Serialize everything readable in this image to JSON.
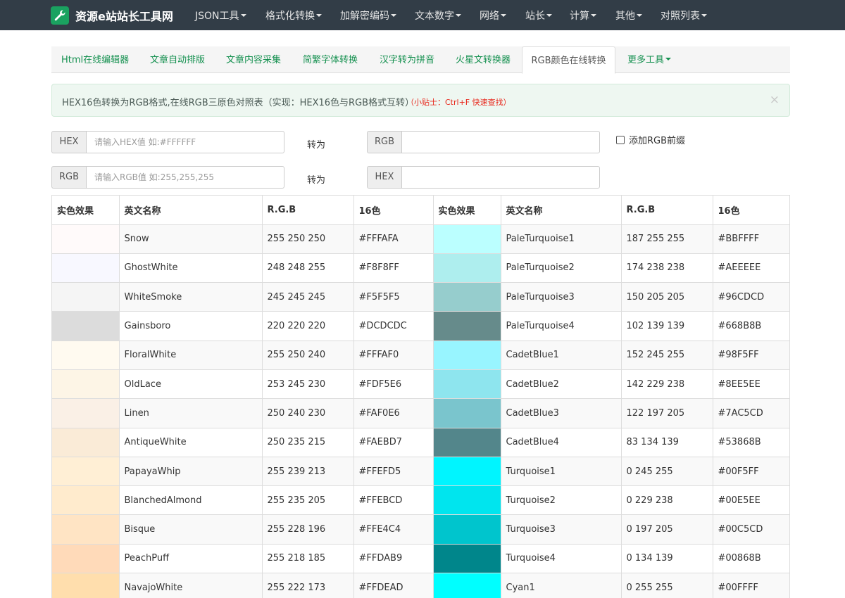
{
  "brand": {
    "name": "资源e站站长工具网",
    "icon": "wrench-icon",
    "icon_bg": "#1aa260"
  },
  "nav": [
    "JSON工具",
    "格式化转换",
    "加解密编码",
    "文本数字",
    "网络",
    "站长",
    "计算",
    "其他",
    "对照列表"
  ],
  "tabs": [
    "Html在线编辑器",
    "文章自动排版",
    "文章内容采集",
    "简繁字体转换",
    "汉字转为拼音",
    "火星文转换器",
    "RGB颜色在线转换",
    "更多工具"
  ],
  "active_tab": 6,
  "alert": {
    "text": "HEX16色转换为RGB格式,在线RGB三原色对照表（实现：HEX16色与RGB格式互转）",
    "tip": "（小贴士：Ctrl+F 快速查找）",
    "close": "×"
  },
  "converter": {
    "row1": {
      "from_label": "HEX",
      "from_placeholder": "请输入HEX值 如:#FFFFFF",
      "to_text": "转为",
      "to_label": "RGB"
    },
    "row2": {
      "from_label": "RGB",
      "from_placeholder": "请输入RGB值 如:255,255,255",
      "to_text": "转为",
      "to_label": "HEX"
    },
    "prefix_label": "添加RGB前缀",
    "prefix_checked": false
  },
  "table": {
    "headers": [
      "实色效果",
      "英文名称",
      "R.G.B",
      "16色",
      "实色效果",
      "英文名称",
      "R.G.B",
      "16色"
    ],
    "rows": [
      {
        "left": {
          "name": "Snow",
          "rgb": "255 250 250",
          "hex": "#FFFAFA"
        },
        "right": {
          "name": "PaleTurquoise1",
          "rgb": "187 255 255",
          "hex": "#BBFFFF"
        }
      },
      {
        "left": {
          "name": "GhostWhite",
          "rgb": "248 248 255",
          "hex": "#F8F8FF"
        },
        "right": {
          "name": "PaleTurquoise2",
          "rgb": "174 238 238",
          "hex": "#AEEEEE"
        }
      },
      {
        "left": {
          "name": "WhiteSmoke",
          "rgb": "245 245 245",
          "hex": "#F5F5F5"
        },
        "right": {
          "name": "PaleTurquoise3",
          "rgb": "150 205 205",
          "hex": "#96CDCD"
        }
      },
      {
        "left": {
          "name": "Gainsboro",
          "rgb": "220 220 220",
          "hex": "#DCDCDC"
        },
        "right": {
          "name": "PaleTurquoise4",
          "rgb": "102 139 139",
          "hex": "#668B8B"
        }
      },
      {
        "left": {
          "name": "FloralWhite",
          "rgb": "255 250 240",
          "hex": "#FFFAF0"
        },
        "right": {
          "name": "CadetBlue1",
          "rgb": "152 245 255",
          "hex": "#98F5FF"
        }
      },
      {
        "left": {
          "name": "OldLace",
          "rgb": "253 245 230",
          "hex": "#FDF5E6"
        },
        "right": {
          "name": "CadetBlue2",
          "rgb": "142 229 238",
          "hex": "#8EE5EE"
        }
      },
      {
        "left": {
          "name": "Linen",
          "rgb": "250 240 230",
          "hex": "#FAF0E6"
        },
        "right": {
          "name": "CadetBlue3",
          "rgb": "122 197 205",
          "hex": "#7AC5CD"
        }
      },
      {
        "left": {
          "name": "AntiqueWhite",
          "rgb": "250 235 215",
          "hex": "#FAEBD7"
        },
        "right": {
          "name": "CadetBlue4",
          "rgb": "83 134 139",
          "hex": "#53868B"
        }
      },
      {
        "left": {
          "name": "PapayaWhip",
          "rgb": "255 239 213",
          "hex": "#FFEFD5"
        },
        "right": {
          "name": "Turquoise1",
          "rgb": "0 245 255",
          "hex": "#00F5FF"
        }
      },
      {
        "left": {
          "name": "BlanchedAlmond",
          "rgb": "255 235 205",
          "hex": "#FFEBCD"
        },
        "right": {
          "name": "Turquoise2",
          "rgb": "0 229 238",
          "hex": "#00E5EE"
        }
      },
      {
        "left": {
          "name": "Bisque",
          "rgb": "255 228 196",
          "hex": "#FFE4C4"
        },
        "right": {
          "name": "Turquoise3",
          "rgb": "0 197 205",
          "hex": "#00C5CD"
        }
      },
      {
        "left": {
          "name": "PeachPuff",
          "rgb": "255 218 185",
          "hex": "#FFDAB9"
        },
        "right": {
          "name": "Turquoise4",
          "rgb": "0 134 139",
          "hex": "#00868B"
        }
      },
      {
        "left": {
          "name": "NavajoWhite",
          "rgb": "255 222 173",
          "hex": "#FFDEAD"
        },
        "right": {
          "name": "Cyan1",
          "rgb": "0 255 255",
          "hex": "#00FFFF"
        }
      }
    ]
  }
}
